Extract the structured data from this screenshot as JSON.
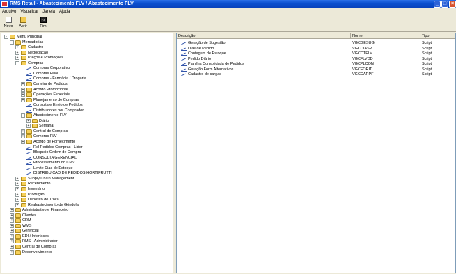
{
  "window": {
    "title": "RMS Retail - Abastecimento FLV / Abastecimento FLV"
  },
  "menubar": [
    "Arquivo",
    "Visualizar",
    "Janela",
    "Ajuda"
  ],
  "toolbar": {
    "novo": "Novo",
    "abrir": "Abrir",
    "fim": "Fim",
    "fim_key": "F3"
  },
  "tree": [
    {
      "label": "Menu Principal",
      "depth": 0,
      "type": "folder",
      "exp": "-"
    },
    {
      "label": "Mercadorias",
      "depth": 1,
      "type": "folder",
      "exp": "-"
    },
    {
      "label": "Cadastro",
      "depth": 2,
      "type": "folder",
      "exp": "+"
    },
    {
      "label": "Negociação",
      "depth": 2,
      "type": "folder",
      "exp": "+"
    },
    {
      "label": "Preços e Promoções",
      "depth": 2,
      "type": "folder",
      "exp": "+"
    },
    {
      "label": "Compras",
      "depth": 2,
      "type": "folder",
      "exp": "-"
    },
    {
      "label": "Compras Corporativo",
      "depth": 3,
      "type": "script",
      "exp": ""
    },
    {
      "label": "Compras Filial",
      "depth": 3,
      "type": "script",
      "exp": ""
    },
    {
      "label": "Compras - Farmácia / Drogaria",
      "depth": 3,
      "type": "script",
      "exp": ""
    },
    {
      "label": "Carteira de Pedidos",
      "depth": 3,
      "type": "folder",
      "exp": "+"
    },
    {
      "label": "Acordo Promocional",
      "depth": 3,
      "type": "folder",
      "exp": "+"
    },
    {
      "label": "Operações Especiais",
      "depth": 3,
      "type": "folder",
      "exp": "+"
    },
    {
      "label": "Planejamento de Compras",
      "depth": 3,
      "type": "folder",
      "exp": "+"
    },
    {
      "label": "Consulta e Envio de Pedidos",
      "depth": 3,
      "type": "script",
      "exp": ""
    },
    {
      "label": "Distribuidores por Comprador",
      "depth": 3,
      "type": "script",
      "exp": ""
    },
    {
      "label": "Abastecimento FLV",
      "depth": 3,
      "type": "folder",
      "exp": "-"
    },
    {
      "label": "Diário",
      "depth": 4,
      "type": "folder",
      "exp": "+"
    },
    {
      "label": "Semanal",
      "depth": 4,
      "type": "folder",
      "exp": "+"
    },
    {
      "label": "Central de Compras",
      "depth": 3,
      "type": "folder",
      "exp": "+"
    },
    {
      "label": "Compras FLV",
      "depth": 3,
      "type": "folder",
      "exp": "+"
    },
    {
      "label": "Acordo de Fornecimento",
      "depth": 3,
      "type": "folder",
      "exp": "+"
    },
    {
      "label": "Rel Pedidos Compras - Lider",
      "depth": 3,
      "type": "script",
      "exp": ""
    },
    {
      "label": "Bloqueio Ordem de Compra",
      "depth": 3,
      "type": "script",
      "exp": ""
    },
    {
      "label": "CONSULTA GERENCIAL",
      "depth": 3,
      "type": "script",
      "exp": ""
    },
    {
      "label": "Processamento do CMV",
      "depth": 3,
      "type": "script",
      "exp": ""
    },
    {
      "label": "Limite Dias de Estoque",
      "depth": 3,
      "type": "script",
      "exp": ""
    },
    {
      "label": "DISTRIBUICAO DE PEDIDOS HORTIFRUTTI",
      "depth": 3,
      "type": "script",
      "exp": ""
    },
    {
      "label": "Supply Chain Management",
      "depth": 2,
      "type": "folder",
      "exp": "+"
    },
    {
      "label": "Recebimento",
      "depth": 2,
      "type": "folder",
      "exp": "+"
    },
    {
      "label": "Inventário",
      "depth": 2,
      "type": "folder",
      "exp": "+"
    },
    {
      "label": "Produção",
      "depth": 2,
      "type": "folder",
      "exp": "+"
    },
    {
      "label": "Depósito de Troca",
      "depth": 2,
      "type": "folder",
      "exp": "+"
    },
    {
      "label": "Reabastecimento de Gôndola",
      "depth": 2,
      "type": "folder",
      "exp": "+"
    },
    {
      "label": "Administrativo e Financeiro",
      "depth": 1,
      "type": "folder",
      "exp": "+"
    },
    {
      "label": "Clientes",
      "depth": 1,
      "type": "folder",
      "exp": "+"
    },
    {
      "label": "CRM",
      "depth": 1,
      "type": "folder",
      "exp": "+"
    },
    {
      "label": "WMS",
      "depth": 1,
      "type": "folder",
      "exp": "+"
    },
    {
      "label": "Gerencial",
      "depth": 1,
      "type": "folder",
      "exp": "+"
    },
    {
      "label": "EDI / Interfaces",
      "depth": 1,
      "type": "folder",
      "exp": "+"
    },
    {
      "label": "RMS - Administrador",
      "depth": 1,
      "type": "folder",
      "exp": "+"
    },
    {
      "label": "Central de Compras",
      "depth": 1,
      "type": "folder",
      "exp": "+"
    },
    {
      "label": "Desenvolvimento",
      "depth": 1,
      "type": "folder",
      "exp": "+"
    }
  ],
  "list": {
    "headers": {
      "desc": "Descrição",
      "nome": "Nome",
      "tipo": "Tipo"
    },
    "rows": [
      {
        "desc": "Geração de Sugestão",
        "nome": "VGCGESUG",
        "tipo": "Script"
      },
      {
        "desc": "Dias de Pedido",
        "nome": "VGCDIASP",
        "tipo": "Script"
      },
      {
        "desc": "Contagem de Estoque",
        "nome": "VGCCTFLV",
        "tipo": "Script"
      },
      {
        "desc": "Pedido Diário",
        "nome": "VGCFLVDD",
        "tipo": "Script"
      },
      {
        "desc": "Planilha Consolidada de Pedidos",
        "nome": "VGCPLCON",
        "tipo": "Script"
      },
      {
        "desc": "Geração Form Alternativos",
        "nome": "VGCFORIT",
        "tipo": "Script"
      },
      {
        "desc": "Cadastro de cargas",
        "nome": "VGCCARPF",
        "tipo": "Script"
      }
    ]
  }
}
